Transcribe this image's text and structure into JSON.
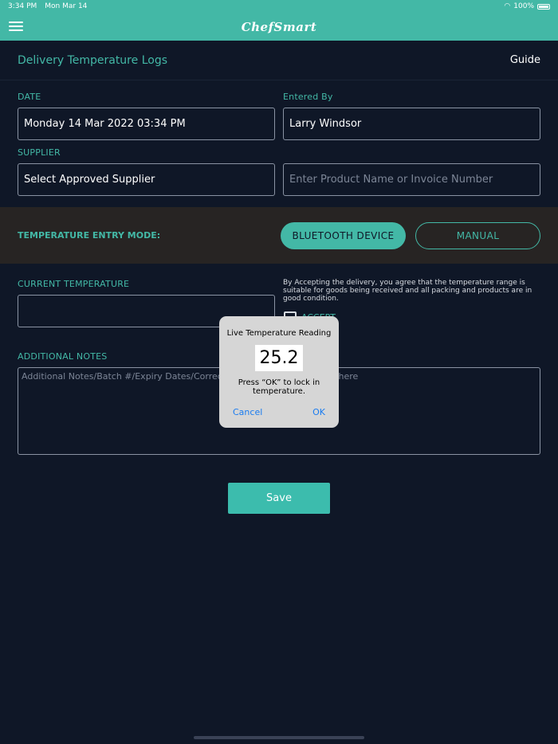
{
  "status": {
    "time": "3:34 PM",
    "date": "Mon Mar 14",
    "battery": "100%"
  },
  "nav": {
    "logo": "ChefSmart"
  },
  "header": {
    "title": "Delivery Temperature Logs",
    "guide": "Guide"
  },
  "form": {
    "date_label": "DATE",
    "date_value": "Monday 14 Mar 2022 03:34 PM",
    "entered_by_label": "Entered By",
    "entered_by_value": "Larry Windsor",
    "supplier_label": "SUPPLIER",
    "supplier_value": "Select Approved Supplier",
    "product_placeholder": "Enter Product Name or Invoice Number",
    "mode_label": "TEMPERATURE ENTRY MODE:",
    "mode_bluetooth": "BLUETOOTH DEVICE",
    "mode_manual": "MANUAL",
    "current_temp_label": "CURRENT TEMPERATURE",
    "current_temp_value": "",
    "agreement": "By Accepting the delivery, you agree that the temperature range is suitable for goods being received and all packing and products are in good condition.",
    "accept_label": "ACCEPT",
    "notes_label": "ADDITIONAL NOTES",
    "notes_placeholder": "Additional Notes/Batch #/Expiry Dates/Corrective actions can be added here",
    "save": "Save"
  },
  "dialog": {
    "title": "Live Temperature Reading",
    "reading": "25.2",
    "message": "Press “OK” to lock in temperature.",
    "cancel": "Cancel",
    "ok": "OK"
  },
  "colors": {
    "accent": "#43b8a6",
    "background": "#0f1727",
    "band": "#272423"
  }
}
